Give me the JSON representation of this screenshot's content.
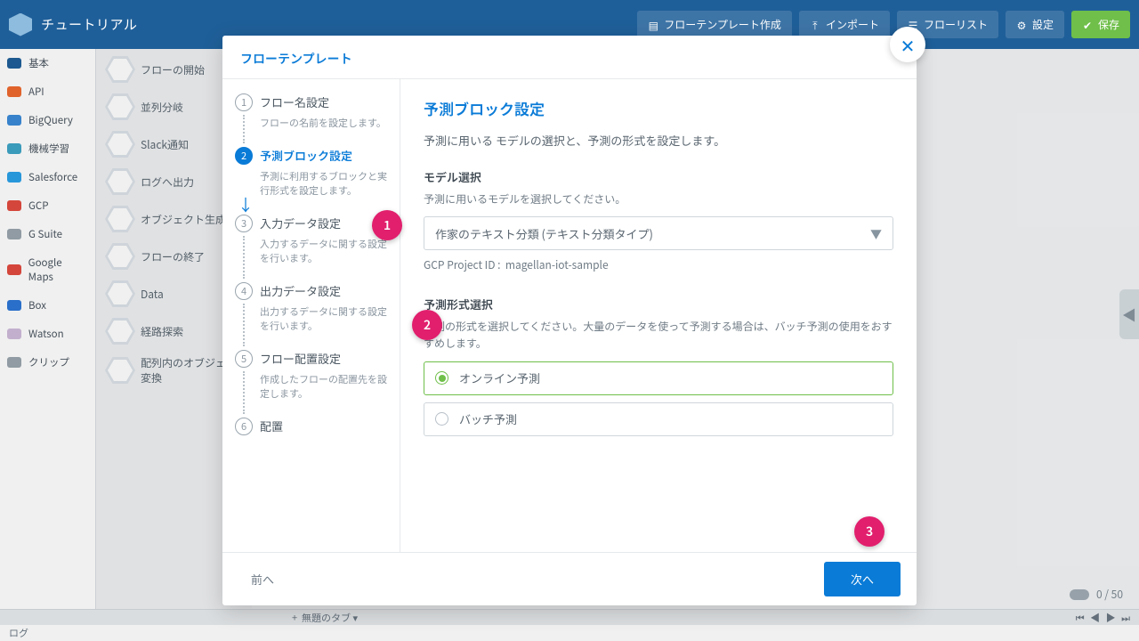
{
  "header": {
    "title": "チュートリアル",
    "buttons": {
      "flow_template_create": "フローテンプレート作成",
      "import": "インポート",
      "flow_list": "フローリスト",
      "settings": "設定",
      "save": "保存"
    }
  },
  "categories": [
    {
      "label": "基本",
      "color": "#1f5f99"
    },
    {
      "label": "API",
      "color": "#ef6a2e"
    },
    {
      "label": "BigQuery",
      "color": "#3b8bd8"
    },
    {
      "label": "機械学習",
      "color": "#3fa5c6"
    },
    {
      "label": "Salesforce",
      "color": "#2aa1e8"
    },
    {
      "label": "GCP",
      "color": "#e24b3f"
    },
    {
      "label": "G Suite",
      "color": "#9aa5ae"
    },
    {
      "label": "Google Maps",
      "color": "#e24b3f"
    },
    {
      "label": "Box",
      "color": "#2d76d6"
    },
    {
      "label": "Watson",
      "color": "#cfbada"
    },
    {
      "label": "クリップ",
      "color": "#9aa5ae"
    }
  ],
  "blocks": [
    "フローの開始",
    "並列分岐",
    "Slack通知",
    "ログへ出力",
    "オブジェクト生成",
    "フローの終了",
    "Data",
    "経路探索",
    "配列内のオブジェクト変換"
  ],
  "canvas": {
    "counter": "0 / 50",
    "log_label": "ログ",
    "tab_dropdown": "無題のタブ"
  },
  "modal": {
    "title": "フローテンプレート",
    "steps": [
      {
        "n": "1",
        "title": "フロー名設定",
        "desc": "フローの名前を設定します。"
      },
      {
        "n": "2",
        "title": "予測ブロック設定",
        "desc": "予測に利用するブロックと実行形式を設定します。",
        "active": true
      },
      {
        "n": "3",
        "title": "入力データ設定",
        "desc": "入力するデータに関する設定を行います。"
      },
      {
        "n": "4",
        "title": "出力データ設定",
        "desc": "出力するデータに関する設定を行います。"
      },
      {
        "n": "5",
        "title": "フロー配置設定",
        "desc": "作成したフローの配置先を設定します。"
      },
      {
        "n": "6",
        "title": "配置",
        "desc": ""
      }
    ],
    "content": {
      "heading": "予測ブロック設定",
      "lead": "予測に用いる モデルの選択と、予測の形式を設定します。",
      "model_section": "モデル選択",
      "model_hint": "予測に用いるモデルを選択してください。",
      "model_value": "作家のテキスト分類 (テキスト分類タイプ)",
      "project_label": "GCP Project ID :",
      "project_value": "magellan-iot-sample",
      "format_section": "予測形式選択",
      "format_hint": "予測の形式を選択してください。大量のデータを使って予測する場合は、バッチ予測の使用をおすすめします。",
      "option_online": "オンライン予測",
      "option_batch": "バッチ予測"
    },
    "footer": {
      "back": "前へ",
      "next": "次へ"
    }
  },
  "pins": {
    "p1": "1",
    "p2": "2",
    "p3": "3"
  }
}
